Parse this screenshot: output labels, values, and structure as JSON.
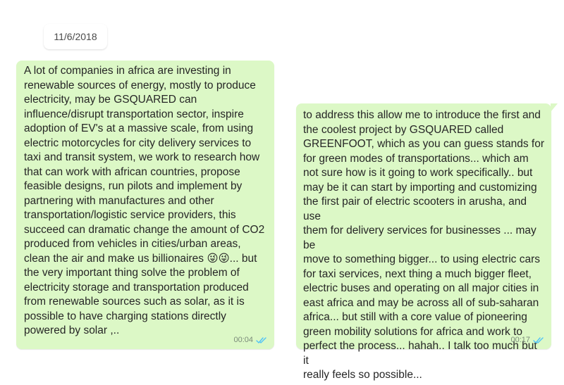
{
  "date_separator": "11/6/2018",
  "messages": [
    {
      "text": "A lot of companies in africa are investing in\nrenewable sources of energy, mostly to produce\nelectricity, may be GSQUARED can\ninfluence/disrupt transportation sector, inspire\nadoption of EV's at a massive scale, from using\nelectric motorcycles for city delivery services to\ntaxi and transit system, we work to research how\nthat can work with african countries, propose\nfeasible designs, run pilots and implement by\npartnering with manufactures and other\ntransportation/logistic service providers, this\nsucceed can dramatic change the amount of CO2\nproduced from vehicles in cities/urban areas,\nclean the air and make us billionaires 😜😜... but\nthe very important thing solve the problem of\nelectricity storage and transportation produced\nfrom renewable sources such as solar, as it is\npossible to have charging stations directly\npowered by solar ,..",
      "time": "00:04",
      "status_icon": "double-check-icon"
    },
    {
      "text": "to address this allow me to introduce the first and\nthe coolest project by GSQUARED called\nGREENFOOT, which as you can guess stands for\nfor green modes of transportations... which am\nnot sure how is it going to work specifically.. but\nmay be it can start by importing and customizing\nthe first pair of electric scooters in arusha, and use\nthem for delivery services for businesses ... may be\nmove to something bigger... to using electric cars\nfor taxi services, next thing a much bigger fleet,\nelectric buses and operating on all major cities in\neast africa and may be across all of sub-saharan\nafrica... but still with a core value of pioneering\ngreen mobility solutions for africa and work to\nperfect the process... hahah.. I talk too much but it\nreally feels so possible...",
      "time": "00:17",
      "status_icon": "double-check-icon"
    }
  ],
  "colors": {
    "bubble_outgoing": "#dcf8c6",
    "read_ticks": "#4fc3f7",
    "meta_text": "#7a8a79"
  }
}
